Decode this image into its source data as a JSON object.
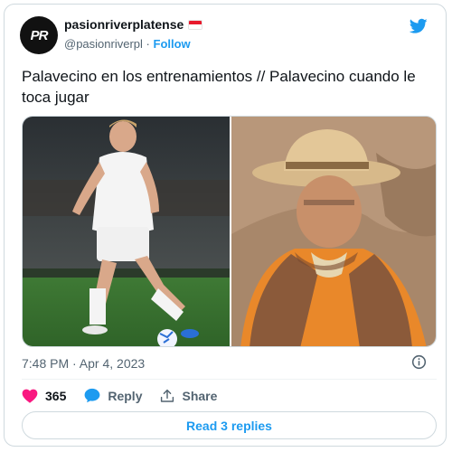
{
  "author": {
    "avatar_text": "PR",
    "name": "pasionriverplatense",
    "handle": "@pasionriverpl",
    "separator": "·",
    "follow_label": "Follow"
  },
  "tweet": {
    "text": "Palavecino en los entrenamientos // Palavecino cuando le toca jugar"
  },
  "meta": {
    "timestamp": "7:48 PM · Apr 4, 2023"
  },
  "actions": {
    "like_count": "365",
    "reply_label": "Reply",
    "share_label": "Share"
  },
  "replies_button": {
    "label": "Read 3 replies"
  },
  "icons": {
    "brand": "twitter-bird-icon",
    "info": "info-icon",
    "like": "heart-icon",
    "reply": "speech-bubble-icon",
    "share": "share-upload-icon"
  },
  "colors": {
    "accent": "#1d9bf0",
    "like": "#f91880",
    "text": "#0f1419",
    "muted": "#536471",
    "border": "#cfd9de"
  }
}
